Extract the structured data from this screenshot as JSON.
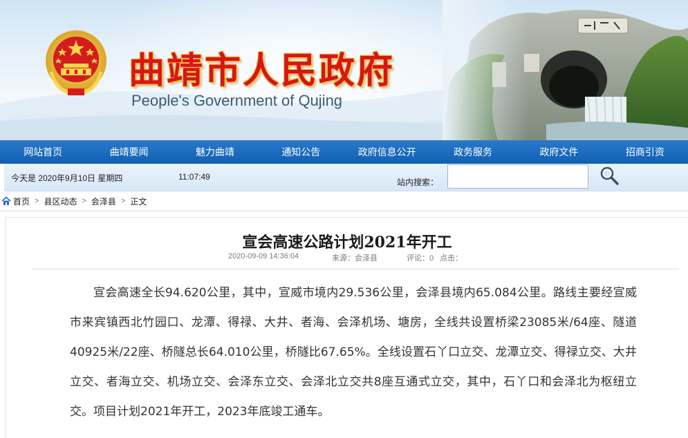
{
  "header": {
    "title": "曲靖市人民政府",
    "subtitle": "People's Government of Qujing",
    "emblem_icon": "national-emblem-icon",
    "brand_color": "#d71616"
  },
  "nav": {
    "items": [
      {
        "label": "网站首页"
      },
      {
        "label": "曲靖要闻"
      },
      {
        "label": "魅力曲靖"
      },
      {
        "label": "通知公告"
      },
      {
        "label": "政府信息公开"
      },
      {
        "label": "政务服务"
      },
      {
        "label": "政府文件"
      },
      {
        "label": "招商引资"
      }
    ],
    "bg_color": "#1565bd"
  },
  "infobar": {
    "date": "今天是 2020年9月10日 星期四",
    "time": "11:07:49",
    "search_label": "站内搜索：",
    "search_value": "",
    "search_icon": "magnifier-icon"
  },
  "breadcrumb": {
    "items": [
      "首页",
      "县区动态",
      "会泽县",
      "正文"
    ]
  },
  "article": {
    "title": "宣会高速公路计划2021年开工",
    "date": "2020-09-09 14:36:04",
    "source": "来源：会泽县",
    "comments": "评论：0",
    "clicks": "点击：",
    "body": "宣会高速全长94.620公里，其中，宣威市境内29.536公里，会泽县境内65.084公里。路线主要经宣威市来宾镇西北竹园口、龙潭、得禄、大井、者海、会泽机场、塘房，全线共设置桥梁23085米/64座、隧道40925米/22座、桥隧总长64.010公里，桥隧比67.65%。全线设置石丫口立交、龙潭立交、得禄立交、大井立交、者海立交、机场立交、会泽东立交、会泽北立交共8座互通式立交，其中，石丫口和会泽北为枢纽立交。项目计划2021年开工，2023年底竣工通车。"
  }
}
